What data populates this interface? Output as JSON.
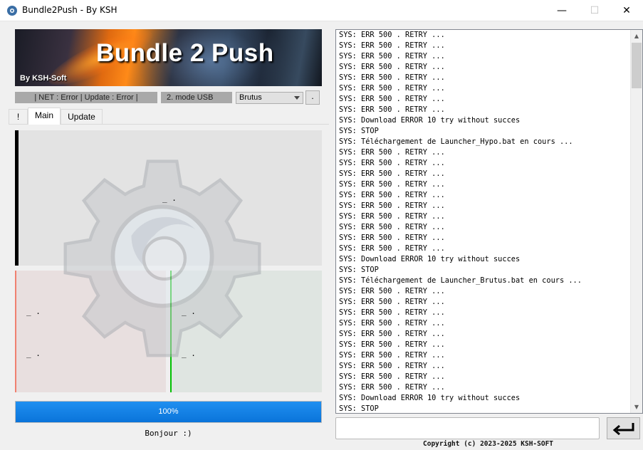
{
  "window": {
    "title": "Bundle2Push - By KSH",
    "icon": "gear-app-icon",
    "controls": {
      "minimize": "—",
      "maximize": "☐",
      "close": "✕"
    }
  },
  "banner": {
    "title": "Bundle 2 Push",
    "subtitle": "By KSH-Soft"
  },
  "status": {
    "net_update": "| NET : Error | Update : Error |",
    "mode": "2. mode USB",
    "profile_selected": "Brutus",
    "dot_button": "."
  },
  "tabs": [
    {
      "label": "!"
    },
    {
      "label": "Main",
      "active": true
    },
    {
      "label": "Update"
    }
  ],
  "main": {
    "top_text": "_ .",
    "left_line1": "_ .",
    "left_line2": "_ .",
    "right_line1": "_ .",
    "right_line2": "_ ."
  },
  "progress": {
    "value": 1.0,
    "label": "100%"
  },
  "greeting": "Bonjour :)",
  "log": {
    "lines": [
      "SYS: ERR 500 . RETRY ...",
      "SYS: ERR 500 . RETRY ...",
      "SYS: ERR 500 . RETRY ...",
      "SYS: ERR 500 . RETRY ...",
      "SYS: ERR 500 . RETRY ...",
      "SYS: ERR 500 . RETRY ...",
      "SYS: ERR 500 . RETRY ...",
      "SYS: ERR 500 . RETRY ...",
      "SYS: Download ERROR 10 try without succes",
      "SYS: STOP",
      "SYS: Téléchargement de Launcher_Hypo.bat en cours ...",
      "SYS: ERR 500 . RETRY ...",
      "SYS: ERR 500 . RETRY ...",
      "SYS: ERR 500 . RETRY ...",
      "SYS: ERR 500 . RETRY ...",
      "SYS: ERR 500 . RETRY ...",
      "SYS: ERR 500 . RETRY ...",
      "SYS: ERR 500 . RETRY ...",
      "SYS: ERR 500 . RETRY ...",
      "SYS: ERR 500 . RETRY ...",
      "SYS: ERR 500 . RETRY ...",
      "SYS: Download ERROR 10 try without succes",
      "SYS: STOP",
      "SYS: Téléchargement de Launcher_Brutus.bat en cours ...",
      "SYS: ERR 500 . RETRY ...",
      "SYS: ERR 500 . RETRY ...",
      "SYS: ERR 500 . RETRY ...",
      "SYS: ERR 500 . RETRY ...",
      "SYS: ERR 500 . RETRY ...",
      "SYS: ERR 500 . RETRY ...",
      "SYS: ERR 500 . RETRY ...",
      "SYS: ERR 500 . RETRY ...",
      "SYS: ERR 500 . RETRY ...",
      "SYS: ERR 500 . RETRY ...",
      "SYS: Download ERROR 10 try without succes",
      "SYS: STOP"
    ]
  },
  "command": {
    "value": "",
    "send_icon": "enter-arrow-icon"
  },
  "footer": {
    "copyright": "Copyright (c) 2023-2025 KSH-SOFT"
  },
  "colors": {
    "progress_fill": "#0a74da",
    "left_bar": "#f08070",
    "right_bar": "#00c000",
    "top_bar": "#000000"
  }
}
